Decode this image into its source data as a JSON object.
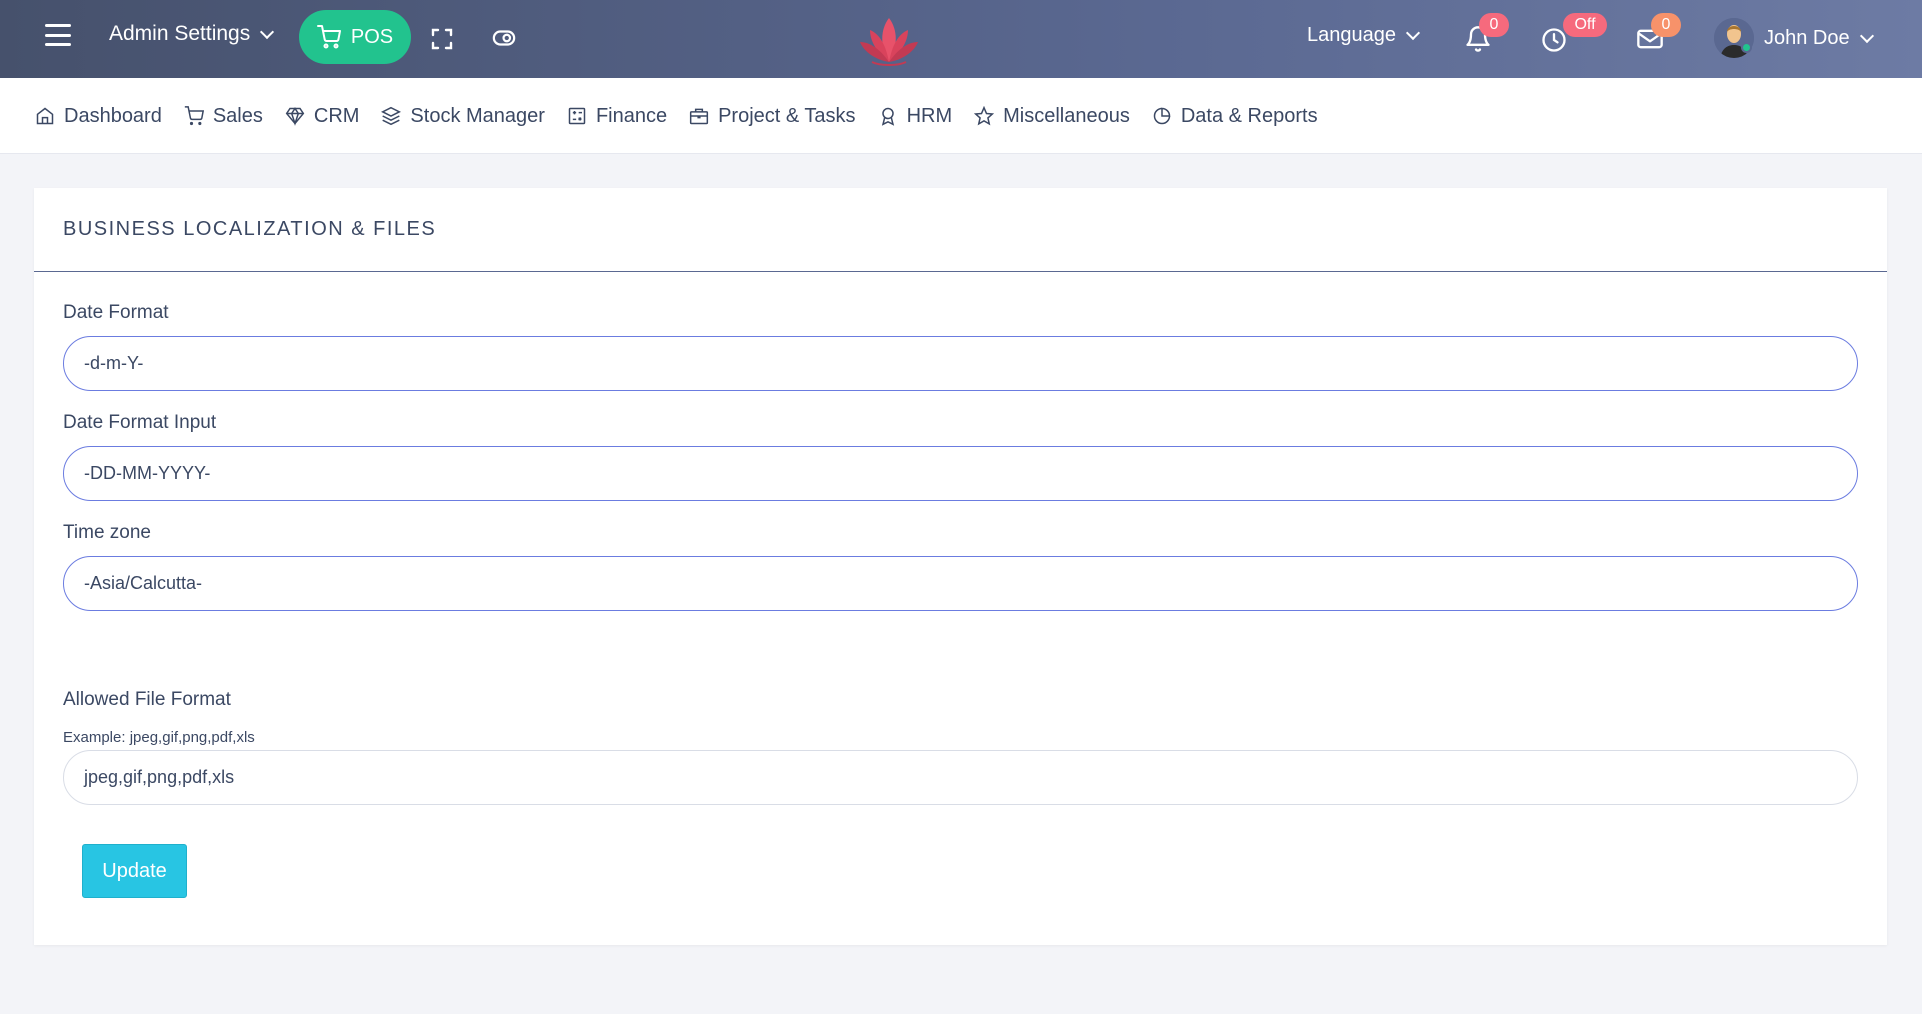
{
  "topbar": {
    "admin_settings": "Admin Settings",
    "pos_label": "POS",
    "language_label": "Language",
    "notifications_count": "0",
    "clock_status": "Off",
    "messages_count": "0",
    "user_name": "John Doe"
  },
  "nav": {
    "items": [
      {
        "label": "Dashboard",
        "icon": "home-icon"
      },
      {
        "label": "Sales",
        "icon": "cart-icon"
      },
      {
        "label": "CRM",
        "icon": "diamond-icon"
      },
      {
        "label": "Stock Manager",
        "icon": "layers-icon"
      },
      {
        "label": "Finance",
        "icon": "calculator-icon"
      },
      {
        "label": "Project & Tasks",
        "icon": "briefcase-icon"
      },
      {
        "label": "HRM",
        "icon": "award-icon"
      },
      {
        "label": "Miscellaneous",
        "icon": "star-icon"
      },
      {
        "label": "Data & Reports",
        "icon": "pie-chart-icon"
      }
    ]
  },
  "form": {
    "title": "Business Localization & Files",
    "date_format_label": "Date Format",
    "date_format_value": "-d-m-Y-",
    "date_format_input_label": "Date Format Input",
    "date_format_input_value": "-DD-MM-YYYY-",
    "timezone_label": "Time zone",
    "timezone_value": "-Asia/Calcutta-",
    "allowed_file_label": "Allowed File Format",
    "allowed_file_hint": "Example: jpeg,gif,png,pdf,xls",
    "allowed_file_value": "jpeg,gif,png,pdf,xls",
    "update_label": "Update"
  },
  "colors": {
    "topbar": "#5a6891",
    "pos": "#22c38e",
    "badge": "#f66a7d",
    "update": "#28c5e3"
  }
}
